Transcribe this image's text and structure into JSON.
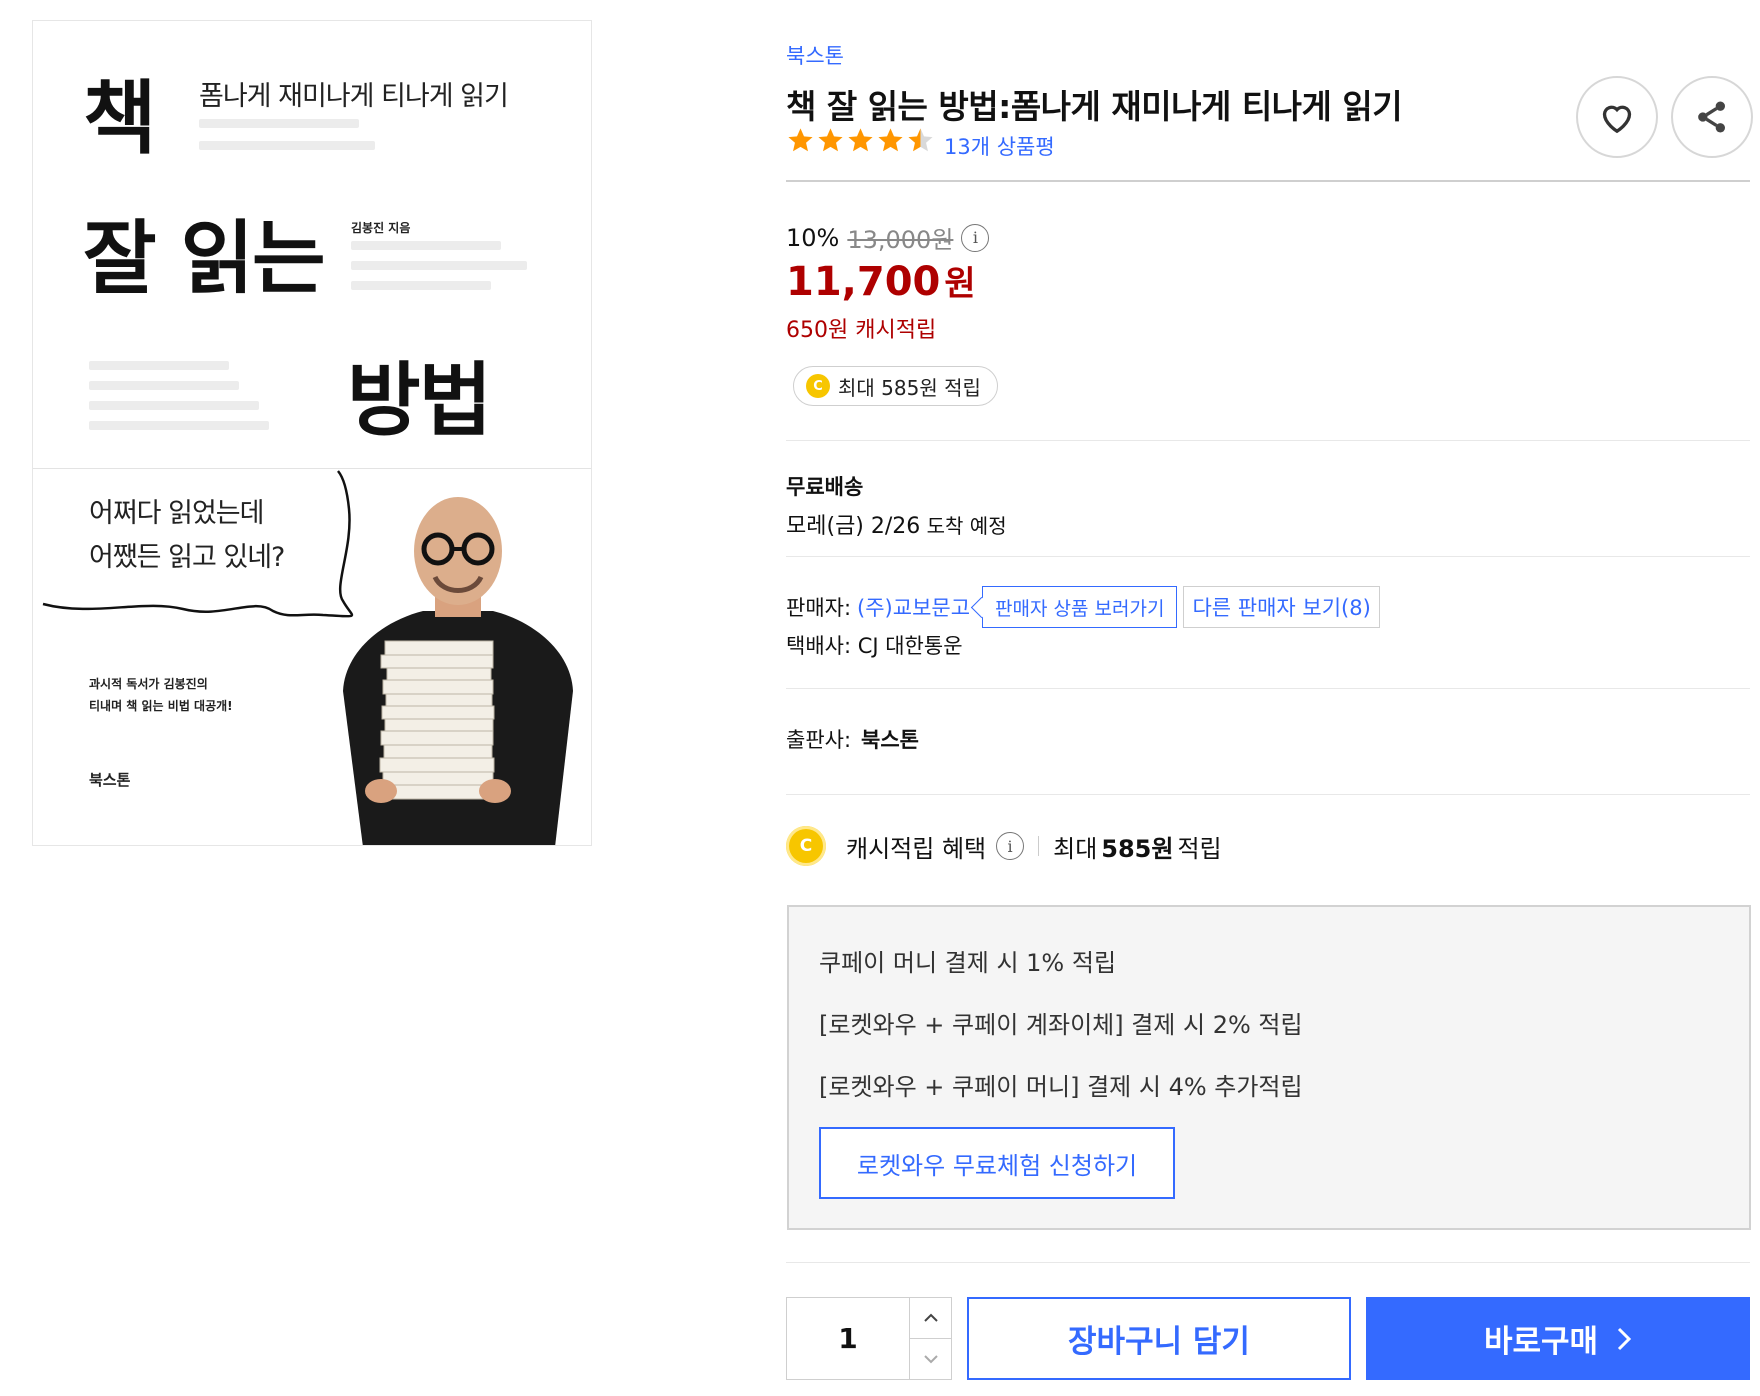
{
  "cover": {
    "big_1": "책",
    "big_2": "잘 읽는",
    "big_3": "방법",
    "subtitle": "폼나게 재미나게 티나게 읽기",
    "author": "김봉진 지음",
    "speech_1": "어쩌다 읽었는데",
    "speech_2": "어쨌든 읽고 있네?",
    "blurb_1": "과시적 독서가 김봉진의",
    "blurb_2": "티내며 책 읽는 비법 대공개!",
    "logo": "북스톤"
  },
  "product": {
    "brand": "북스톤",
    "title": "책 잘 읽는 방법:폼나게 재미나게 티나게 읽기",
    "rating": 4.5,
    "review_count": "13개 상품평",
    "wish_icon": "heart-icon",
    "share_icon": "share-icon"
  },
  "price": {
    "discount_rate": "10%",
    "original": "13,000원",
    "info": "i",
    "sale_amount": "11,700",
    "sale_unit": "원",
    "cash_reward": "650원 캐시적립",
    "max_reward": "최대 585원 적립",
    "coin": "C"
  },
  "shipping": {
    "title": "무료배송",
    "date_main": "모레(금) 2/26",
    "date_suffix": " 도착 예정"
  },
  "seller": {
    "label": "판매자:",
    "name": "(주)교보문고",
    "seller_products_button": "판매자 상품 보러가기",
    "other_sellers_button": "다른 판매자 보기(8)",
    "courier_label": "택배사: CJ 대한통운",
    "publisher_label": "출판사:",
    "publisher": "북스톤"
  },
  "benefit": {
    "title": "캐시적립 혜택",
    "max_prefix": "최대",
    "max_amount": "585원",
    "max_suffix": "적립",
    "lines": [
      "쿠페이 머니 결제 시 1% 적립",
      "[로켓와우 + 쿠페이 계좌이체] 결제 시 2% 적립",
      "[로켓와우 + 쿠페이 머니] 결제 시 4% 추가적립"
    ],
    "trial_button": "로켓와우 무료체험 신청하기"
  },
  "purchase": {
    "quantity": "1",
    "cart_button": "장바구니 담기",
    "buy_button": "바로구매"
  },
  "colors": {
    "accent": "#346aff",
    "price_red": "#ae0000",
    "star": "#ff9600",
    "coin": "#f7c600"
  }
}
